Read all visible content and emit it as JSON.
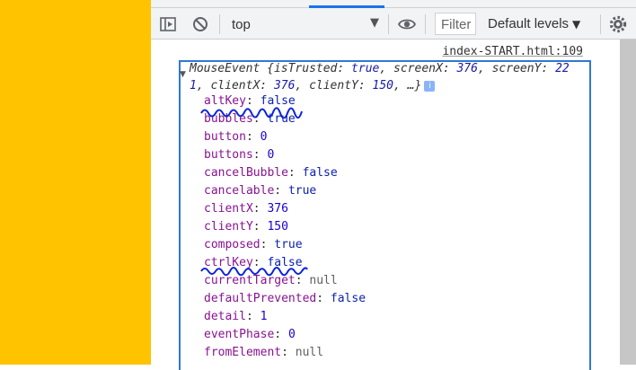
{
  "toolbar": {
    "context": "top",
    "filter_placeholder": "Filter",
    "levels_label": "Default levels",
    "icons": [
      "sidebar-toggle-icon",
      "clear-console-icon",
      "chevron-down-icon",
      "eye-icon",
      "gear-icon"
    ]
  },
  "console": {
    "source_link": "index-START.html:109",
    "summary": {
      "name": "MouseEvent",
      "is_trusted": "true",
      "screen_x": "376",
      "screen_y_part1": "22",
      "screen_y_part2": "1",
      "client_x": "376",
      "client_y": "150",
      "ellipsis": "…"
    },
    "properties": [
      {
        "key": "altKey",
        "value": "false",
        "type": "bool"
      },
      {
        "key": "bubbles",
        "value": "true",
        "type": "bool"
      },
      {
        "key": "button",
        "value": "0",
        "type": "num"
      },
      {
        "key": "buttons",
        "value": "0",
        "type": "num"
      },
      {
        "key": "cancelBubble",
        "value": "false",
        "type": "bool"
      },
      {
        "key": "cancelable",
        "value": "true",
        "type": "bool"
      },
      {
        "key": "clientX",
        "value": "376",
        "type": "num"
      },
      {
        "key": "clientY",
        "value": "150",
        "type": "num"
      },
      {
        "key": "composed",
        "value": "true",
        "type": "bool"
      },
      {
        "key": "ctrlKey",
        "value": "false",
        "type": "bool"
      },
      {
        "key": "currentTarget",
        "value": "null",
        "type": "null"
      },
      {
        "key": "defaultPrevented",
        "value": "false",
        "type": "bool"
      },
      {
        "key": "detail",
        "value": "1",
        "type": "num"
      },
      {
        "key": "eventPhase",
        "value": "0",
        "type": "num"
      },
      {
        "key": "fromElement",
        "value": "null",
        "type": "null"
      }
    ]
  },
  "colors": {
    "page_background": "#ffc300",
    "highlight_border": "#2f78d6",
    "annotation": "#0b24d9",
    "property_key": "#881391"
  }
}
